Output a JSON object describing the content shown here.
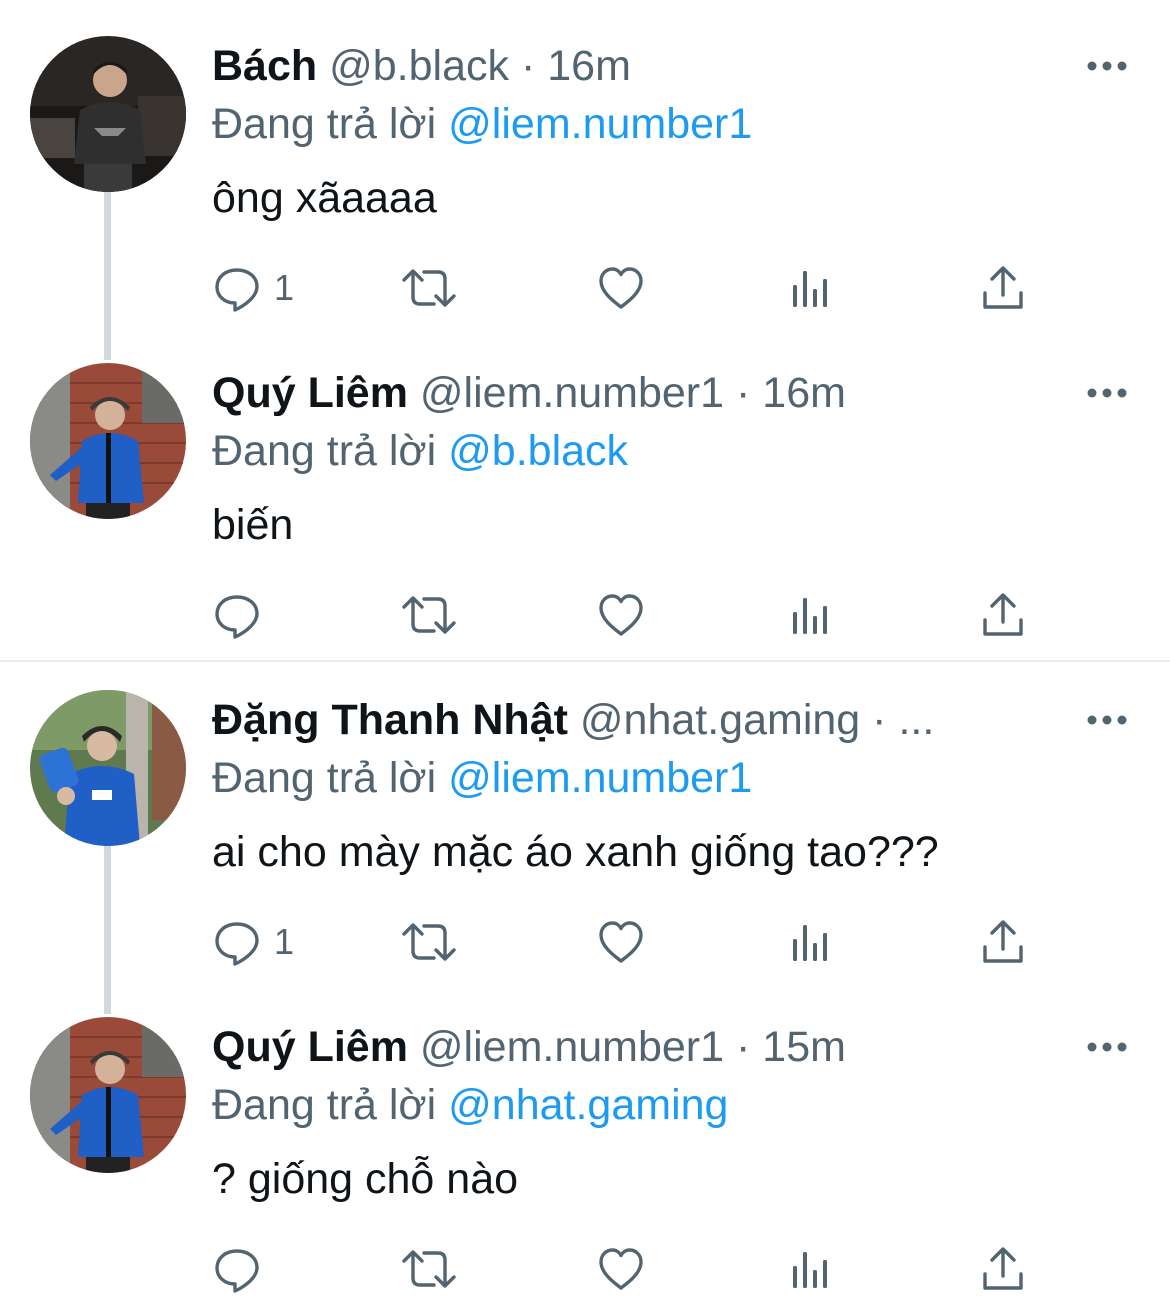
{
  "tweets": [
    {
      "name": "Bách",
      "handle": "@b.black",
      "separator": "·",
      "time": "16m",
      "replying_prefix": "Đang trả lời",
      "replying_to": "@liem.number1",
      "text": "ông xãaaaa",
      "reply_count": "1",
      "avatar_icon": "avatar-dark-shirt",
      "more_icon": "more-icon"
    },
    {
      "name": "Quý Liêm",
      "handle": "@liem.number1",
      "separator": "·",
      "time": "16m",
      "replying_prefix": "Đang trả lời",
      "replying_to": "@b.black",
      "text": "biến",
      "reply_count": "",
      "avatar_icon": "avatar-blue-jacket",
      "more_icon": "more-icon"
    },
    {
      "name": "Đặng Thanh Nhật",
      "handle": "@nhat.gaming",
      "separator": "·",
      "time": "...",
      "replying_prefix": "Đang trả lời",
      "replying_to": "@liem.number1",
      "text": "ai cho mày mặc áo xanh giống tao???",
      "reply_count": "1",
      "avatar_icon": "avatar-blue-shirt-sneaker",
      "more_icon": "more-icon"
    },
    {
      "name": "Quý Liêm",
      "handle": "@liem.number1",
      "separator": "·",
      "time": "15m",
      "replying_prefix": "Đang trả lời",
      "replying_to": "@nhat.gaming",
      "text": "? giống chỗ nào",
      "reply_count": "",
      "avatar_icon": "avatar-blue-jacket",
      "more_icon": "more-icon"
    }
  ],
  "colors": {
    "text_primary": "#0f1419",
    "text_secondary": "#536471",
    "mention": "#1d9bf0",
    "thread_line": "#cfd9de",
    "divider": "#e6ecf0"
  }
}
